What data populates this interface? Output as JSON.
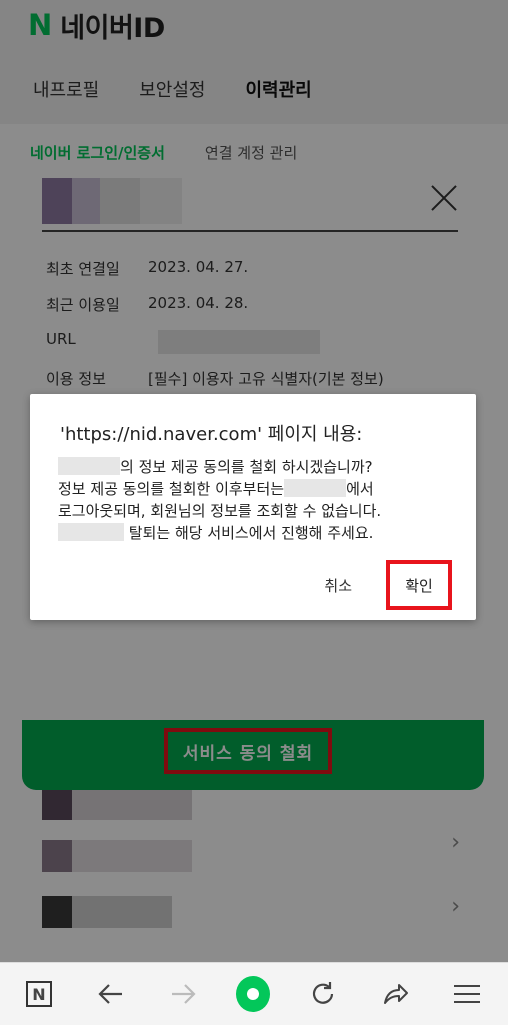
{
  "app": {
    "logo_letter": "N",
    "title": "네이버ID"
  },
  "tabs": [
    {
      "label": "내프로필",
      "active": false
    },
    {
      "label": "보안설정",
      "active": false
    },
    {
      "label": "이력관리",
      "active": true
    }
  ],
  "subtabs": [
    {
      "label": "네이버 로그인/인증서",
      "active": true
    },
    {
      "label": "연결 계정 관리",
      "active": false
    }
  ],
  "panel": {
    "first_connected_label": "최초 연결일",
    "first_connected_value": "2023. 04. 27.",
    "last_used_label": "최근 이용일",
    "last_used_value": "2023. 04. 28.",
    "url_label": "URL",
    "usage_label": "이용 정보",
    "usage_value": "[필수] 이용자 고유 식별자(기본 정보)",
    "revoke_button": "서비스 동의 철회"
  },
  "dialog": {
    "title": "'https://nid.naver.com' 페이지 내용:",
    "line1_suffix": "의 정보 제공 동의를 철회 하시겠습니까?",
    "line2_prefix": "정보 제공 동의를 철회한 이후부터는",
    "line2_suffix": "에서",
    "line3": "로그아웃되며, 회원님의 정보를 조회할 수 없습니다.",
    "line4_suffix": "탈퇴는 해당 서비스에서 진행해 주세요.",
    "cancel": "취소",
    "ok": "확인"
  },
  "colors": {
    "brand_green": "#03c75a",
    "highlight_red": "#e8141c"
  },
  "bottom_bar": {
    "icons": [
      "naver-n-icon",
      "back-arrow-icon",
      "forward-arrow-icon",
      "home-icon",
      "refresh-icon",
      "share-icon",
      "menu-icon"
    ]
  }
}
